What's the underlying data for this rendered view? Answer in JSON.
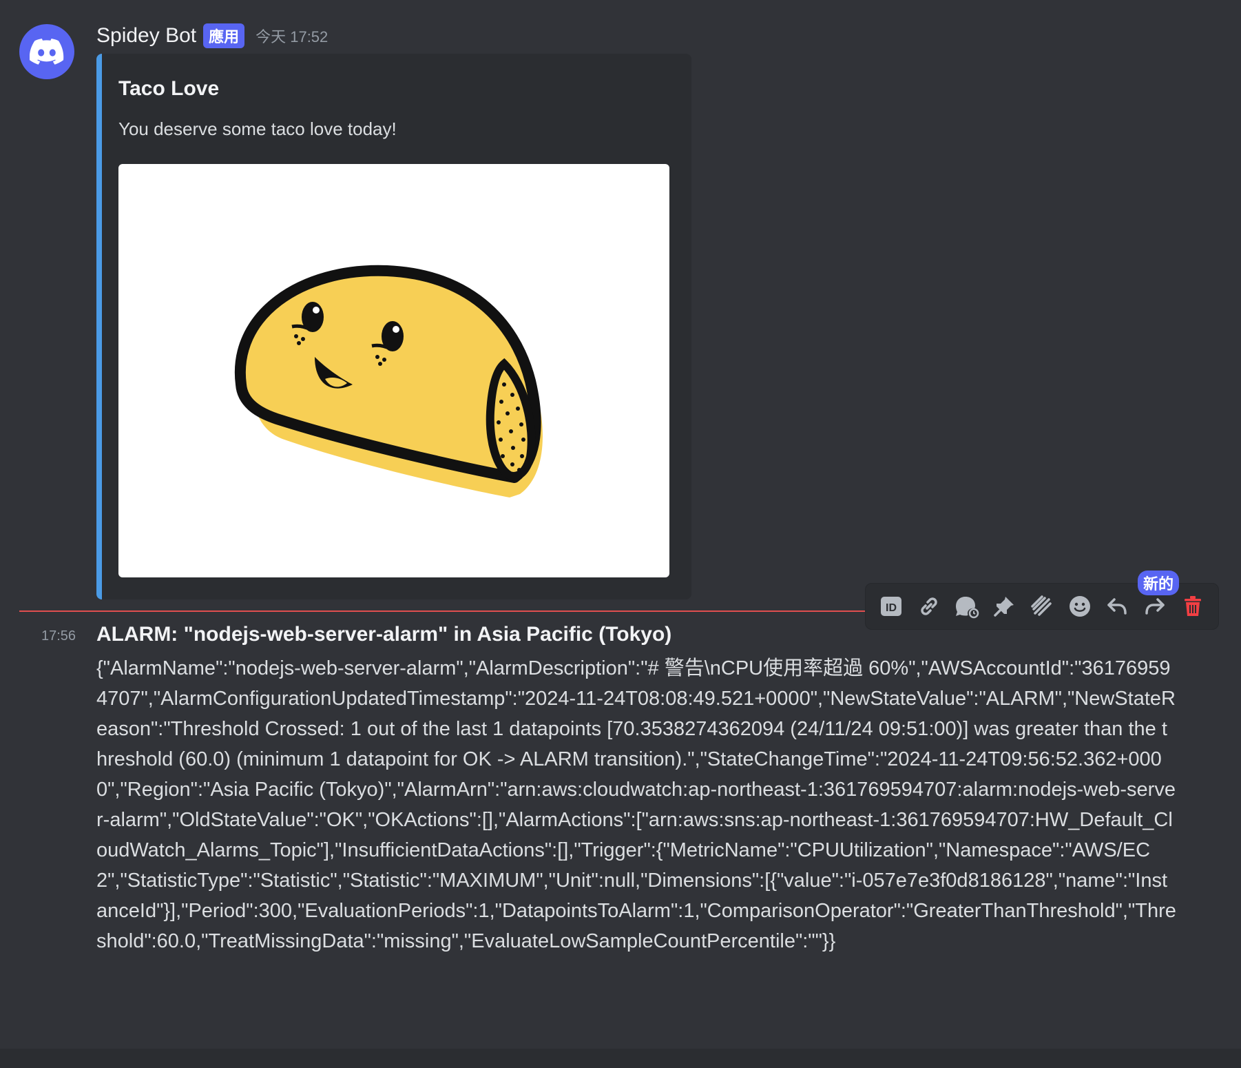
{
  "message1": {
    "username": "Spidey Bot",
    "badge": "應用",
    "timestamp": "今天 17:52",
    "embed": {
      "title": "Taco Love",
      "description": "You deserve some taco love today!"
    }
  },
  "toolbar": {
    "new_badge": "新的",
    "buttons": [
      "id-icon",
      "link-icon",
      "thread-icon",
      "pin-icon",
      "boost-icon",
      "emoji-icon",
      "reply-icon",
      "forward-icon",
      "trash-icon"
    ]
  },
  "message2": {
    "time": "17:56",
    "title": "ALARM: \"nodejs-web-server-alarm\" in Asia Pacific (Tokyo)",
    "body": "{\"AlarmName\":\"nodejs-web-server-alarm\",\"AlarmDescription\":\"# 警告\\nCPU使用率超過 60%\",\"AWSAccountId\":\"361769594707\",\"AlarmConfigurationUpdatedTimestamp\":\"2024-11-24T08:08:49.521+0000\",\"NewStateValue\":\"ALARM\",\"NewStateReason\":\"Threshold Crossed: 1 out of the last 1 datapoints [70.3538274362094 (24/11/24 09:51:00)] was greater than the threshold (60.0) (minimum 1 datapoint for OK -> ALARM transition).\",\"StateChangeTime\":\"2024-11-24T09:56:52.362+0000\",\"Region\":\"Asia Pacific (Tokyo)\",\"AlarmArn\":\"arn:aws:cloudwatch:ap-northeast-1:361769594707:alarm:nodejs-web-server-alarm\",\"OldStateValue\":\"OK\",\"OKActions\":[],\"AlarmActions\":[\"arn:aws:sns:ap-northeast-1:361769594707:HW_Default_CloudWatch_Alarms_Topic\"],\"InsufficientDataActions\":[],\"Trigger\":{\"MetricName\":\"CPUUtilization\",\"Namespace\":\"AWS/EC2\",\"StatisticType\":\"Statistic\",\"Statistic\":\"MAXIMUM\",\"Unit\":null,\"Dimensions\":[{\"value\":\"i-057e7e3f0d8186128\",\"name\":\"InstanceId\"}],\"Period\":300,\"EvaluationPeriods\":1,\"DatapointsToAlarm\":1,\"ComparisonOperator\":\"GreaterThanThreshold\",\"Threshold\":60.0,\"TreatMissingData\":\"missing\",\"EvaluateLowSampleCountPercentile\":\"\"}}"
  },
  "colors": {
    "background": "#313338",
    "embed_bg": "#2b2d31",
    "embed_border": "#4b9be6",
    "blurple": "#5865f2",
    "divider_red": "#e04f4f",
    "delete_red": "#f23f43"
  }
}
